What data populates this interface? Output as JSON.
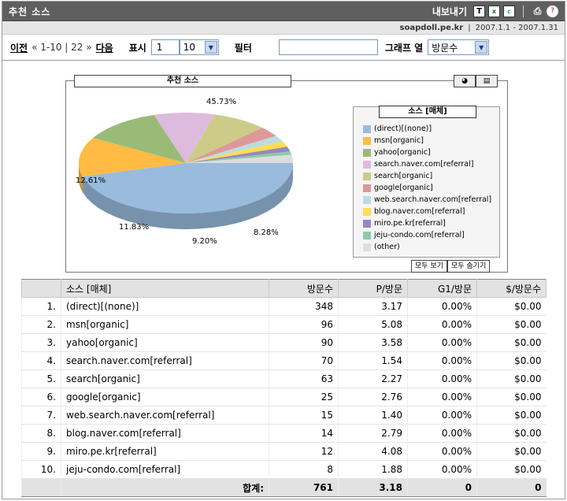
{
  "header": {
    "title": "추천 소스",
    "export_label": "내보내기",
    "export_icons": [
      "T",
      "x",
      "c"
    ],
    "site": "soapdoll.pe.kr",
    "daterange": "2007.1.1 - 2007.1.31"
  },
  "nav": {
    "prev": "이전",
    "range": "« 1-10 | 22 »",
    "next": "다음",
    "display_label": "표시",
    "display_start": "1",
    "display_count": "10",
    "filter_label": "필터",
    "filter_value": "",
    "graph_label": "그래프 열",
    "graph_value": "방문수"
  },
  "chart": {
    "title": "추천 소스",
    "legend_title": "소스 [매체]",
    "show_all": "모두 보기",
    "hide_all": "모두 숨기기",
    "pie_labels": [
      "45.73%",
      "12.61%",
      "11.83%",
      "9.20%",
      "8.28%"
    ],
    "colors": [
      "#99bbdd",
      "#ffbb44",
      "#99bb77",
      "#ddbbdd",
      "#cccc88",
      "#dd9999",
      "#bbdddd",
      "#ffdd55",
      "#9988bb",
      "#88ccaa",
      "#dddddd"
    ]
  },
  "chart_data": {
    "type": "pie",
    "categories": [
      "(direct)[(none)]",
      "msn[organic]",
      "yahoo[organic]",
      "search.naver.com[referral]",
      "search[organic]",
      "google[organic]",
      "web.search.naver.com[referral]",
      "blog.naver.com[referral]",
      "miro.pe.kr[referral]",
      "jeju-condo.com[referral]",
      "(other)"
    ],
    "values": [
      348,
      96,
      90,
      70,
      63,
      25,
      15,
      14,
      12,
      8,
      20
    ]
  },
  "legend_items": [
    "(direct)[(none)]",
    "msn[organic]",
    "yahoo[organic]",
    "search.naver.com[referral]",
    "search[organic]",
    "google[organic]",
    "web.search.naver.com[referral]",
    "blog.naver.com[referral]",
    "miro.pe.kr[referral]",
    "jeju-condo.com[referral]",
    "(other)"
  ],
  "table": {
    "headers": [
      "",
      "소스 [매체]",
      "방문수",
      "P/방문",
      "G1/방문",
      "$/방문수"
    ],
    "rows": [
      {
        "idx": "1.",
        "source": "(direct)[(none)]",
        "visits": "348",
        "pv": "3.17",
        "g1": "0.00%",
        "dv": "$0.00"
      },
      {
        "idx": "2.",
        "source": "msn[organic]",
        "visits": "96",
        "pv": "5.08",
        "g1": "0.00%",
        "dv": "$0.00"
      },
      {
        "idx": "3.",
        "source": "yahoo[organic]",
        "visits": "90",
        "pv": "3.58",
        "g1": "0.00%",
        "dv": "$0.00"
      },
      {
        "idx": "4.",
        "source": "search.naver.com[referral]",
        "visits": "70",
        "pv": "1.54",
        "g1": "0.00%",
        "dv": "$0.00"
      },
      {
        "idx": "5.",
        "source": "search[organic]",
        "visits": "63",
        "pv": "2.27",
        "g1": "0.00%",
        "dv": "$0.00"
      },
      {
        "idx": "6.",
        "source": "google[organic]",
        "visits": "25",
        "pv": "2.76",
        "g1": "0.00%",
        "dv": "$0.00"
      },
      {
        "idx": "7.",
        "source": "web.search.naver.com[referral]",
        "visits": "15",
        "pv": "1.40",
        "g1": "0.00%",
        "dv": "$0.00"
      },
      {
        "idx": "8.",
        "source": "blog.naver.com[referral]",
        "visits": "14",
        "pv": "2.79",
        "g1": "0.00%",
        "dv": "$0.00"
      },
      {
        "idx": "9.",
        "source": "miro.pe.kr[referral]",
        "visits": "12",
        "pv": "4.08",
        "g1": "0.00%",
        "dv": "$0.00"
      },
      {
        "idx": "10.",
        "source": "jeju-condo.com[referral]",
        "visits": "8",
        "pv": "1.88",
        "g1": "0.00%",
        "dv": "$0.00"
      }
    ],
    "total": {
      "label": "합계:",
      "visits": "761",
      "pv": "3.18",
      "g1": "0",
      "dv": "0"
    }
  }
}
